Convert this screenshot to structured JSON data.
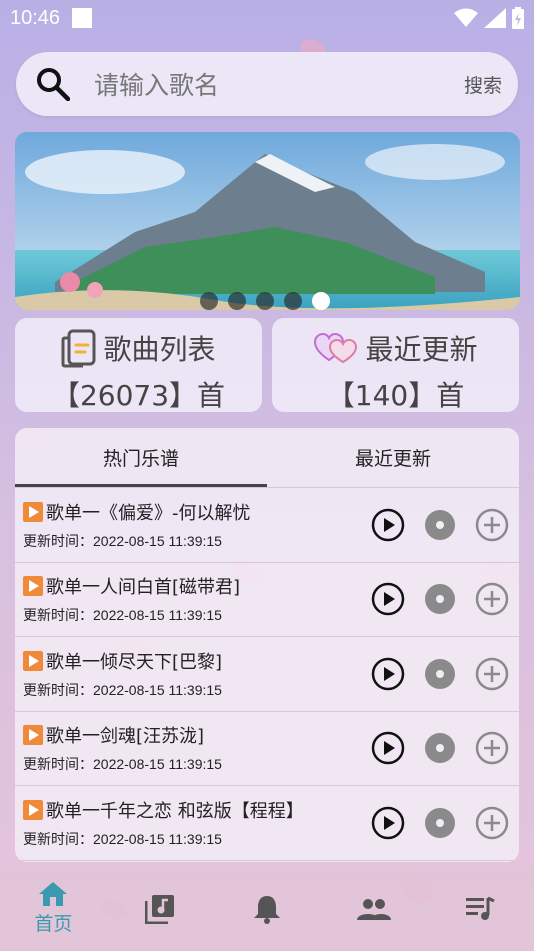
{
  "status_bar": {
    "time": "10:46"
  },
  "search": {
    "placeholder": "请输入歌名",
    "button_label": "搜索"
  },
  "banner": {
    "dot_count": 5,
    "active_dot": 4
  },
  "stats": [
    {
      "label": "歌曲列表",
      "count": "【26073】首",
      "icon": "document-icon"
    },
    {
      "label": "最近更新",
      "count": "【140】首",
      "icon": "hearts-icon"
    }
  ],
  "tabs": [
    {
      "label": "热门乐谱",
      "active": true
    },
    {
      "label": "最近更新",
      "active": false
    }
  ],
  "songs": [
    {
      "name": "歌单一《偏爱》-何以解忧",
      "time": "更新时间：2022-08-15 11:39:15"
    },
    {
      "name": "歌单一人间白首[磁带君]",
      "time": "更新时间：2022-08-15 11:39:15"
    },
    {
      "name": "歌单一倾尽天下[巴黎]",
      "time": "更新时间：2022-08-15 11:39:15"
    },
    {
      "name": "歌单一剑魂[汪苏泷]",
      "time": "更新时间：2022-08-15 11:39:15"
    },
    {
      "name": "歌单一千年之恋 和弦版【程程】",
      "time": "更新时间：2022-08-15 11:39:15"
    }
  ],
  "nav": [
    {
      "label": "首页",
      "icon": "home-icon",
      "active": true
    },
    {
      "label": "",
      "icon": "music-library-icon",
      "active": false
    },
    {
      "label": "",
      "icon": "bell-icon",
      "active": false
    },
    {
      "label": "",
      "icon": "people-icon",
      "active": false
    },
    {
      "label": "",
      "icon": "playlist-icon",
      "active": false
    }
  ],
  "colors": {
    "accent": "#3a9ab0",
    "play_tag": "#f08a3a",
    "icon_gray": "#8a8a8a"
  }
}
